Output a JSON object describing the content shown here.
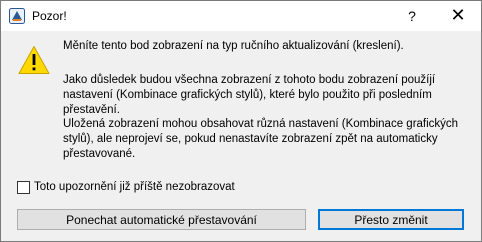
{
  "window": {
    "title": "Pozor!",
    "help_label": "?",
    "close_label": "✕"
  },
  "message": {
    "line1": "Měníte tento bod zobrazení na typ ručního aktualizování (kreslení).",
    "paragraph2": "Jako důsledek budou všechna zobrazení z tohoto bodu zobrazení použíjí nastavení (Kombinace grafických stylů), které bylo použito při posledním přestavění.",
    "paragraph3": "Uložená zobrazení mohou obsahovat různá nastavení (Kombinace grafických stylů), ale neprojeví se, pokud nenastavíte zobrazení zpět na automaticky přestavované."
  },
  "checkbox": {
    "label": "Toto upozornění již příště nezobrazovat",
    "checked": false
  },
  "buttons": {
    "keep_label": "Ponechat automatické přestavování",
    "change_label": "Přesto změnit"
  },
  "icons": {
    "app": "app-icon",
    "warning": "warning-icon"
  },
  "colors": {
    "warning_fill": "#ffd800",
    "focus_border": "#0078d7"
  }
}
